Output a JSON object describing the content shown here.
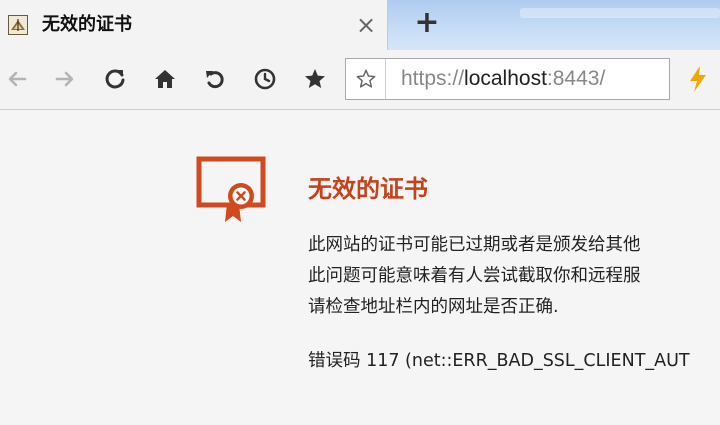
{
  "tab": {
    "title": "无效的证书",
    "close_glyph": "×",
    "favicon": "moth-favicon-icon"
  },
  "newtab": {
    "glyph": "+"
  },
  "toolbar": {
    "back_icon": "arrow-left-icon",
    "forward_icon": "arrow-right-icon",
    "reload_icon": "reload-icon",
    "home_icon": "home-icon",
    "undo_icon": "undo-icon",
    "history_icon": "clock-icon",
    "bookmarks_icon": "star-icon",
    "extension_icon": "lightning-icon"
  },
  "address": {
    "scheme": "https://",
    "host": "localhost",
    "port": ":8443/",
    "star_icon": "star-outline-icon"
  },
  "error": {
    "title": "无效的证书",
    "lines": [
      "此网站的证书可能已过期或者是颁发给其他",
      "此问题可能意味着有人尝试截取你和远程服",
      "请检查地址栏内的网址是否正确."
    ],
    "code": "错误码 117 (net::ERR_BAD_SSL_CLIENT_AUT"
  },
  "colors": {
    "accent": "#d04a1e",
    "title": "#c5411a",
    "flash": "#f0a800"
  }
}
